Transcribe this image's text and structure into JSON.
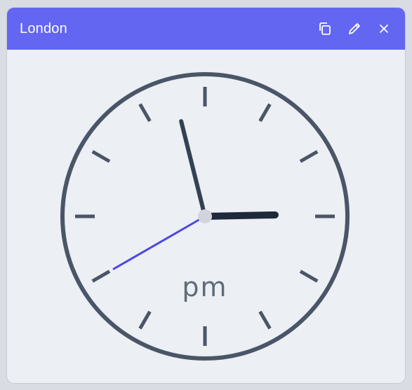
{
  "widget": {
    "title": "London",
    "accent_color": "#6366f1",
    "actions": [
      {
        "name": "duplicate",
        "icon": "copy-icon"
      },
      {
        "name": "edit",
        "icon": "pencil-icon"
      },
      {
        "name": "close",
        "icon": "close-icon"
      }
    ]
  },
  "clock": {
    "period": "pm",
    "hours": 2,
    "minutes": 57,
    "seconds": 40,
    "face_color": "#4a5568",
    "hour_hand_color": "#1e293b",
    "minute_hand_color": "#334155",
    "second_hand_color": "#4f46e5",
    "center_color": "#d1d5db"
  }
}
